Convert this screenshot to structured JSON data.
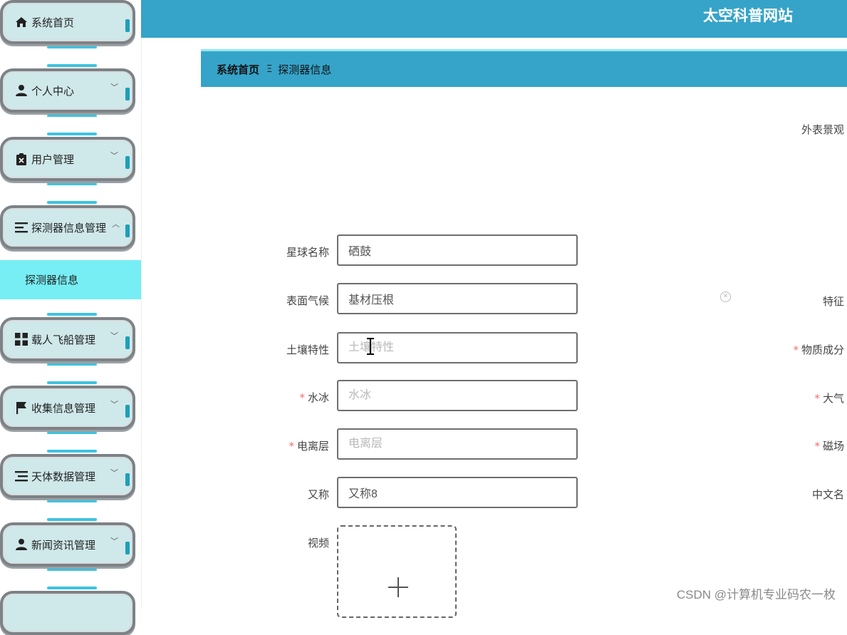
{
  "header": {
    "site_title": "太空科普网站"
  },
  "sidebar": {
    "items": [
      {
        "label": "系统首页",
        "icon": "home-icon",
        "has_arrow": false
      },
      {
        "label": "个人中心",
        "icon": "person-icon",
        "has_arrow": true
      },
      {
        "label": "用户管理",
        "icon": "clipboard-icon",
        "has_arrow": true
      },
      {
        "label": "探测器信息管理",
        "icon": "list-icon",
        "has_arrow": true,
        "expanded": true
      },
      {
        "label": "载人飞船管理",
        "icon": "grid-icon",
        "has_arrow": true
      },
      {
        "label": "收集信息管理",
        "icon": "flag-icon",
        "has_arrow": true
      },
      {
        "label": "天体数据管理",
        "icon": "list-icon",
        "has_arrow": true
      },
      {
        "label": "新闻资讯管理",
        "icon": "person-icon",
        "has_arrow": true
      }
    ],
    "active_submenu": "探测器信息",
    "arrow_down": "﹀",
    "arrow_up": "︿"
  },
  "breadcrumb": {
    "home": "系统首页",
    "separator": "Ξ",
    "current": "探测器信息"
  },
  "form": {
    "top_right_label": "外表景观",
    "fields": [
      {
        "label": "星球名称",
        "required": false,
        "value": "硒鼓",
        "placeholder": "星球名称"
      },
      {
        "label": "表面气候",
        "required": false,
        "value": "基材压根",
        "placeholder": "表面气候"
      },
      {
        "label": "土壤特性",
        "required": false,
        "value": "",
        "placeholder": "土壤特性"
      },
      {
        "label": "水冰",
        "required": true,
        "value": "",
        "placeholder": "水冰"
      },
      {
        "label": "电离层",
        "required": true,
        "value": "",
        "placeholder": "电离层"
      },
      {
        "label": "又称",
        "required": false,
        "value": "又称8",
        "placeholder": "又称"
      }
    ],
    "right_labels": [
      {
        "label": "特征",
        "required": false
      },
      {
        "label": "物质成分",
        "required": true
      },
      {
        "label": "大气",
        "required": true
      },
      {
        "label": "磁场",
        "required": true
      },
      {
        "label": "中文名",
        "required": false
      }
    ],
    "video_label": "视频",
    "required_mark": "*"
  },
  "watermark": "CSDN @计算机专业码农一枚",
  "colors": {
    "header": "#36a3c8",
    "active_submenu": "#76eef4",
    "required": "#f56c6c"
  }
}
